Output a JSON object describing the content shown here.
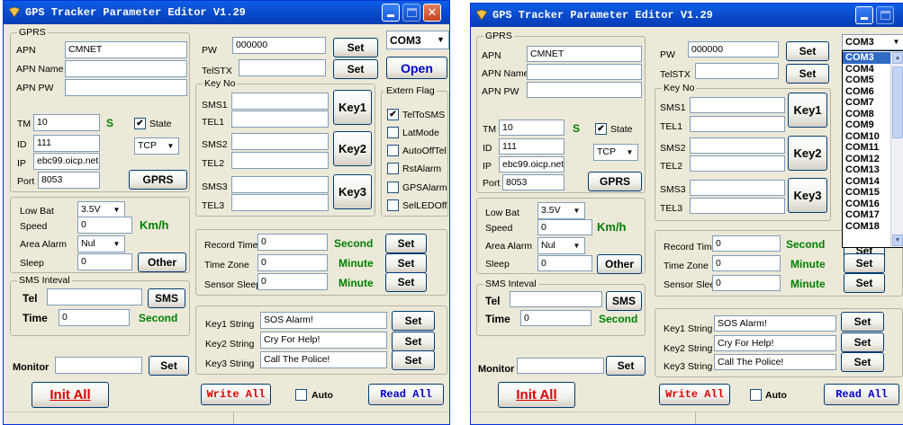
{
  "title": "GPS Tracker Parameter Editor V1.29",
  "gprs": {
    "group_label": "GPRS",
    "apn_label": "APN",
    "apn_value": "CMNET",
    "apn_name_label": "APN Name",
    "apn_name_value": "",
    "apn_pw_label": "APN PW",
    "apn_pw_value": "",
    "tm_label": "TM",
    "tm_value": "10",
    "tm_unit": "S",
    "state_label": "State",
    "state_checked": "✔",
    "id_label": "ID",
    "id_value": "111",
    "protocol": "TCP",
    "ip_label": "IP",
    "ip_value": "ebc99.oicp.net",
    "port_label": "Port",
    "port_value": "8053",
    "gprs_button": "GPRS"
  },
  "power": {
    "low_bat_label": "Low Bat",
    "low_bat_value": "3.5V",
    "speed_label": "Speed",
    "speed_value": "0",
    "speed_unit": "Km/h",
    "area_alarm_label": "Area Alarm",
    "area_alarm_value": "Nul",
    "sleep_label": "Sleep",
    "sleep_value": "0",
    "other_button": "Other"
  },
  "sms": {
    "group_label": "SMS Inteval",
    "tel_label": "Tel",
    "tel_value": "",
    "sms_button": "SMS",
    "time_label": "Time",
    "time_value": "0",
    "time_unit": "Second"
  },
  "monitor": {
    "label": "Monitor",
    "value": "",
    "set_button": "Set"
  },
  "pw": {
    "label": "PW",
    "value": "000000",
    "set_button": "Set"
  },
  "telstx": {
    "label": "TelSTX",
    "value": "",
    "set_button": "Set"
  },
  "com": {
    "value": "COM3",
    "open_button": "Open"
  },
  "keyno": {
    "group_label": "Key No",
    "sms1_label": "SMS1",
    "tel1_label": "TEL1",
    "key1_button": "Key1",
    "sms2_label": "SMS2",
    "tel2_label": "TEL2",
    "key2_button": "Key2",
    "sms3_label": "SMS3",
    "tel3_label": "TEL3",
    "key3_button": "Key3"
  },
  "extern_flag": {
    "group_label": "Extern Flag",
    "items": [
      {
        "label": "TelToSMS",
        "check": "✔"
      },
      {
        "label": "LatMode",
        "check": ""
      },
      {
        "label": "AutoOffTel",
        "check": ""
      },
      {
        "label": "RstAlarm",
        "check": ""
      },
      {
        "label": "GPSAlarm",
        "check": ""
      },
      {
        "label": "SelLEDOff",
        "check": ""
      }
    ]
  },
  "timing": {
    "record_time_label": "Record Time",
    "record_time_value": "0",
    "record_time_unit": "Second",
    "time_zone_label": "Time Zone",
    "time_zone_value": "0",
    "time_zone_unit": "Minute",
    "sensor_sleep_label": "Sensor Sleep",
    "sensor_sleep_value": "0",
    "sensor_sleep_unit": "Minute",
    "set_button": "Set"
  },
  "keystrings": {
    "key1_label": "Key1 String",
    "key1_value": "SOS Alarm!",
    "key2_label": "Key2 String",
    "key2_value": "Cry For Help!",
    "key3_label": "Key3 String",
    "key3_value": "Call The Police!",
    "set_button": "Set"
  },
  "footer": {
    "init_all": "Init All",
    "write_all": "Write All",
    "auto_label": "Auto",
    "read_all": "Read All"
  },
  "com_dropdown": [
    "COM3",
    "COM4",
    "COM5",
    "COM6",
    "COM7",
    "COM8",
    "COM9",
    "COM10",
    "COM11",
    "COM12",
    "COM13",
    "COM14",
    "COM15",
    "COM16",
    "COM17",
    "COM18"
  ],
  "colors": {
    "accent_green": "#008000",
    "red": "#e00000",
    "blue": "#0000cc",
    "title_blue": "#0a5fe8"
  }
}
